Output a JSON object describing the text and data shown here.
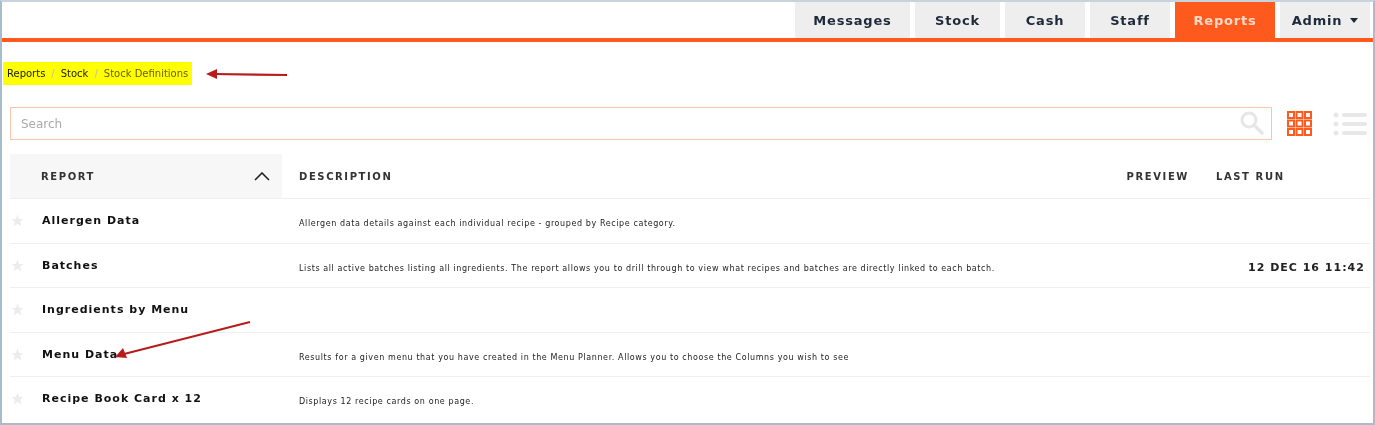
{
  "nav": {
    "tabs": [
      {
        "label": "Messages",
        "selected": false,
        "dropdown": false
      },
      {
        "label": "Stock",
        "selected": false,
        "dropdown": false
      },
      {
        "label": "Cash",
        "selected": false,
        "dropdown": false
      },
      {
        "label": "Staff",
        "selected": false,
        "dropdown": false
      },
      {
        "label": "Reports",
        "selected": true,
        "dropdown": false
      },
      {
        "label": "Admin",
        "selected": false,
        "dropdown": true
      }
    ]
  },
  "breadcrumb": {
    "highlighted": true,
    "separator": "/",
    "items": [
      "Reports",
      "Stock",
      "Stock Definitions"
    ]
  },
  "search": {
    "placeholder": "Search"
  },
  "view_toggle": {
    "grid_selected": true
  },
  "table": {
    "columns": [
      {
        "label": "REPORT",
        "sorted": true
      },
      {
        "label": "DESCRIPTION",
        "sorted": false
      },
      {
        "label": "PREVIEW",
        "sorted": false
      },
      {
        "label": "LAST RUN",
        "sorted": false
      }
    ],
    "rows": [
      {
        "name": "Allergen Data",
        "starred": false,
        "description": "Allergen data details against each individual recipe - grouped by Recipe category."
      },
      {
        "name": "Batches",
        "starred": false,
        "description": "Lists all active batches listing all ingredients. The report allows you to drill through to view what recipes and batches are directly linked to each batch.",
        "last_run": "12 DEC 16 11:42"
      },
      {
        "name": "Ingredients by Menu",
        "starred": false
      },
      {
        "name": "Menu Data",
        "starred": false,
        "description": "Results for a given menu that you have created in the Menu Planner. Allows you to choose the Columns you wish to see"
      },
      {
        "name": "Recipe Book Card x 12",
        "starred": false,
        "description": "Displays 12 recipe cards on one page."
      }
    ]
  }
}
